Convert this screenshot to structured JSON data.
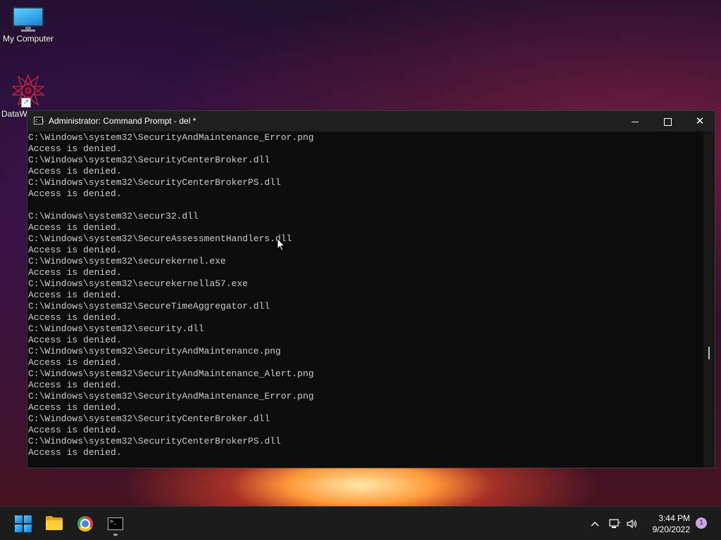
{
  "desktop": {
    "icons": [
      {
        "label": "My Computer",
        "icon": "monitor-icon"
      },
      {
        "label": "DataW",
        "icon": "datawarrior-icon"
      }
    ]
  },
  "window": {
    "title": "Administrator: Command Prompt - del  *",
    "app_icon": "cmd-icon",
    "app_icon_text": "C:\\",
    "buttons": {
      "minimize": "minimize-icon",
      "maximize": "maximize-icon",
      "close": "close-icon"
    }
  },
  "console": {
    "lines": [
      "C:\\Windows\\system32\\SecurityAndMaintenance_Error.png",
      "Access is denied.",
      "C:\\Windows\\system32\\SecurityCenterBroker.dll",
      "Access is denied.",
      "C:\\Windows\\system32\\SecurityCenterBrokerPS.dll",
      "Access is denied.",
      "",
      "C:\\Windows\\system32\\secur32.dll",
      "Access is denied.",
      "C:\\Windows\\system32\\SecureAssessmentHandlers.dll",
      "Access is denied.",
      "C:\\Windows\\system32\\securekernel.exe",
      "Access is denied.",
      "C:\\Windows\\system32\\securekernella57.exe",
      "Access is denied.",
      "C:\\Windows\\system32\\SecureTimeAggregator.dll",
      "Access is denied.",
      "C:\\Windows\\system32\\security.dll",
      "Access is denied.",
      "C:\\Windows\\system32\\SecurityAndMaintenance.png",
      "Access is denied.",
      "C:\\Windows\\system32\\SecurityAndMaintenance_Alert.png",
      "Access is denied.",
      "C:\\Windows\\system32\\SecurityAndMaintenance_Error.png",
      "Access is denied.",
      "C:\\Windows\\system32\\SecurityCenterBroker.dll",
      "Access is denied.",
      "C:\\Windows\\system32\\SecurityCenterBrokerPS.dll",
      "Access is denied."
    ]
  },
  "taskbar": {
    "apps": [
      {
        "name": "start",
        "icon": "windows-start-icon"
      },
      {
        "name": "file-explorer",
        "icon": "folder-icon"
      },
      {
        "name": "chrome",
        "icon": "chrome-icon"
      },
      {
        "name": "command-prompt",
        "icon": "cmd-icon",
        "text": ">_"
      }
    ],
    "tray": {
      "chevron_icon": "chevron-up-icon",
      "network_icon": "network-icon",
      "volume_icon": "speaker-icon",
      "time": "3:44 PM",
      "date": "9/20/2022",
      "notification_count": "1"
    }
  },
  "colors": {
    "console_bg": "#0c0c0c",
    "console_text": "#cccccc",
    "titlebar_bg": "#1f1f1f",
    "taskbar_bg": "#1c1c1c"
  }
}
